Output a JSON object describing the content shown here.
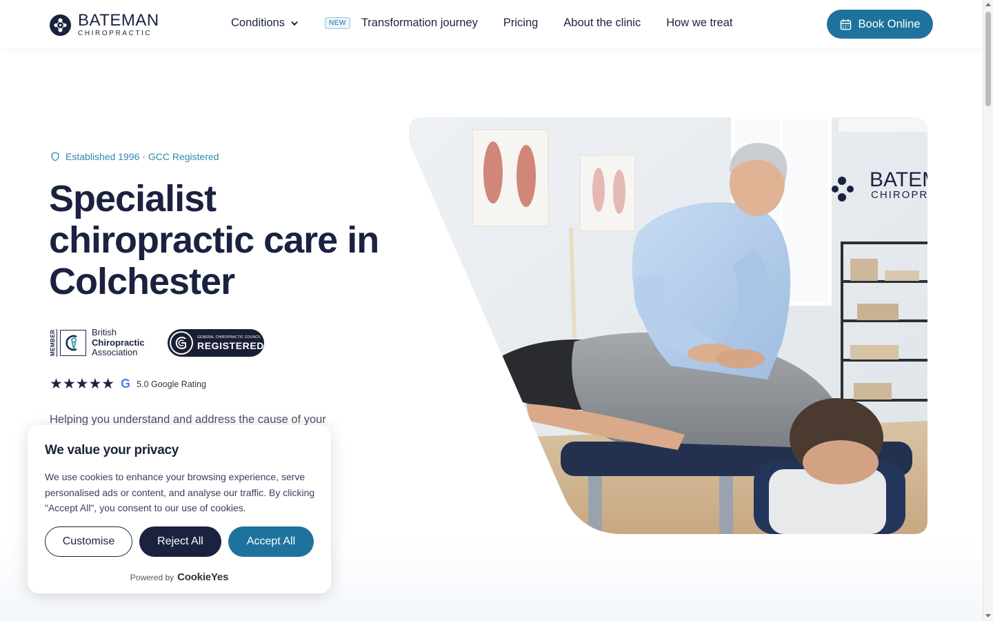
{
  "header": {
    "logo": {
      "name": "BATEMAN",
      "sub": "CHIROPRACTIC"
    },
    "nav": {
      "conditions": "Conditions",
      "new_badge": "NEW",
      "transformation": "Transformation journey",
      "pricing": "Pricing",
      "about": "About the clinic",
      "how_we_treat": "How we treat"
    },
    "book_button": "Book Online"
  },
  "hero": {
    "eyebrow": "Established 1996 · GCC Registered",
    "title": "Specialist chiropractic care in Colchester",
    "association": {
      "member": "MEMBER",
      "line1": "British",
      "line2": "Chiropractic",
      "line3": "Association"
    },
    "gcc_badge": {
      "small": "GENERAL CHIROPRACTIC COUNCIL",
      "big": "REGISTERED"
    },
    "rating": {
      "stars": 5,
      "star_glyphs": "★★★★★",
      "google_glyph": "G",
      "text": "5.0 Google Rating"
    },
    "paragraph": "Helping you understand and address the cause of your",
    "image_wall_sign": {
      "line1": "BATEM",
      "line2": "CHIROPRA"
    }
  },
  "cookie_banner": {
    "title": "We value your privacy",
    "body": "We use cookies to enhance your browsing experience, serve personalised ads or content, and analyse our traffic. By clicking \"Accept All\", you consent to our use of cookies.",
    "customise": "Customise",
    "reject": "Reject All",
    "accept": "Accept All",
    "powered_by": "Powered by",
    "brand": "CookieYes"
  },
  "colors": {
    "navy": "#1a2240",
    "accent": "#1e739c",
    "eyebrow": "#2f87ad"
  }
}
